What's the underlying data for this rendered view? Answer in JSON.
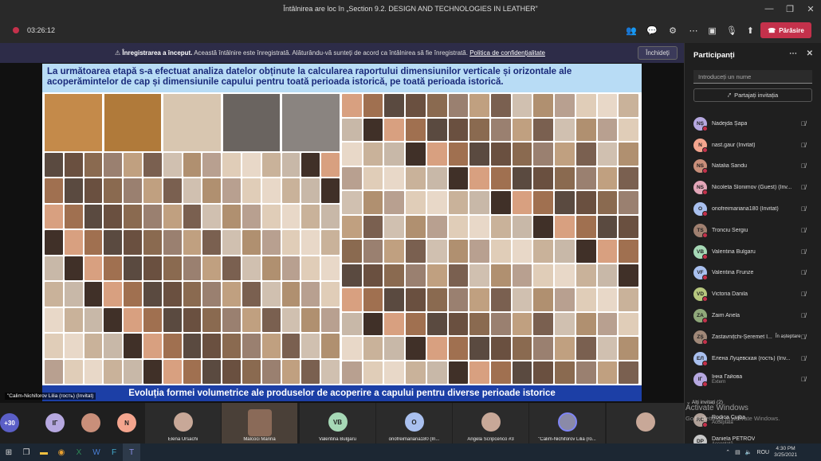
{
  "window": {
    "title": "Întâlnirea are loc în „Section 9.2. DESIGN AND TECHNOLOGIES IN LEATHER”"
  },
  "toolbar": {
    "timer": "03:26:12",
    "leave_label": "Părăsire"
  },
  "banner": {
    "bold": "Înregistrarea a început.",
    "text": " Această întâlnire este înregistrată. Alăturându-vă sunteți de acord ca întâlnirea să fie înregistrată. ",
    "link": "Politica de confidențialitate",
    "close_label": "Închideți"
  },
  "slide": {
    "title": "La următoarea etapă s-a efectuat analiza datelor obținute la calcularea raportului dimensiunilor verticale și orizontale ale acoperămintelor de cap și dimensiunile capului pentru toată perioada istorică, pe toată perioada istorică.",
    "footer": "Evoluția formei volumetrice ale produselor de acoperire a capului pentru diverse perioade istorice"
  },
  "stage": {
    "presenter_label": "\"Calim-Nichiforov Lilia (гость) (Invitat)"
  },
  "panel": {
    "title": "Participanți",
    "search_placeholder": "Introduceți un nume",
    "share_label": "Partajați invitația",
    "participants": [
      {
        "initials": "NȘ",
        "name": "Nadejda Șapa",
        "color": "#b6a8e0"
      },
      {
        "initials": "N",
        "name": "nast.gaur (Invitat)",
        "color": "#f4a58e"
      },
      {
        "initials": "NS",
        "name": "Natalia Sandu",
        "color": "#c98f7a"
      },
      {
        "initials": "NS",
        "name": "Nicoleta Slonimov (Guest) (Inv...",
        "color": "#e3a6b8"
      },
      {
        "initials": "O",
        "name": "onofreimariana180 (Invitat)",
        "color": "#a9c0ef"
      },
      {
        "initials": "TS",
        "name": "Tronciu Sergiu",
        "color": "#a08070"
      },
      {
        "initials": "VB",
        "name": "Valentina Bulgaru",
        "color": "#a6d8b6"
      },
      {
        "initials": "VF",
        "name": "Valentina Frunze",
        "color": "#a9c0ef"
      },
      {
        "initials": "VD",
        "name": "Victoria Danila",
        "color": "#b7c77e"
      },
      {
        "initials": "ZA",
        "name": "Zaim Anela",
        "color": "#8fa87a"
      },
      {
        "initials": "ZȘ",
        "name": "Zastavnițchi-Șeremet I...",
        "note": "În așteptare",
        "color": "#a08878"
      },
      {
        "initials": "EЛ",
        "name": "Елена Луцевская (гость) (Inv...",
        "color": "#a9c0ef"
      },
      {
        "initials": "IГ",
        "name": "Інна Гайова",
        "sub": "Extern",
        "color": "#b6a8e0"
      }
    ],
    "others_label": "Alți invitați (2)",
    "others": [
      {
        "initials": "RC",
        "name": "Rodica Cujba",
        "sub": "Acceptată",
        "color": "#b0a098"
      },
      {
        "initials": "DP",
        "name": "Daniela PETROV",
        "sub": "Acceptată",
        "color": "#c8c8c8"
      }
    ]
  },
  "strip": {
    "more_count": "+30",
    "tiles": [
      {
        "name": "Elena Ursachi",
        "kind": "photo"
      },
      {
        "name": "Malcoci Marina",
        "kind": "video"
      },
      {
        "name": "Valentina Bulgaru",
        "initials": "VB",
        "kind": "avatar",
        "color": "#a6d8b6"
      },
      {
        "name": "onofreimariana180 (In...",
        "initials": "O",
        "kind": "avatar",
        "color": "#a9c0ef"
      },
      {
        "name": "Angela Scripcenco #3",
        "kind": "photo"
      },
      {
        "name": "\"Calim-Nichiforov Lilia (ro...",
        "kind": "presenter"
      },
      {
        "name": "",
        "kind": "photo"
      }
    ],
    "small_avatars": [
      {
        "initials": "IГ",
        "color": "#b6a8e0"
      },
      {
        "initials": "",
        "color": "#c98f7a"
      },
      {
        "initials": "N",
        "color": "#f4a58e"
      }
    ]
  },
  "watermark": {
    "line1": "Activate Windows",
    "line2": "Go to Settings to activate Windows."
  },
  "taskbar": {
    "lang": "ROU",
    "time": "4:30 PM",
    "date": "3/25/2021"
  }
}
